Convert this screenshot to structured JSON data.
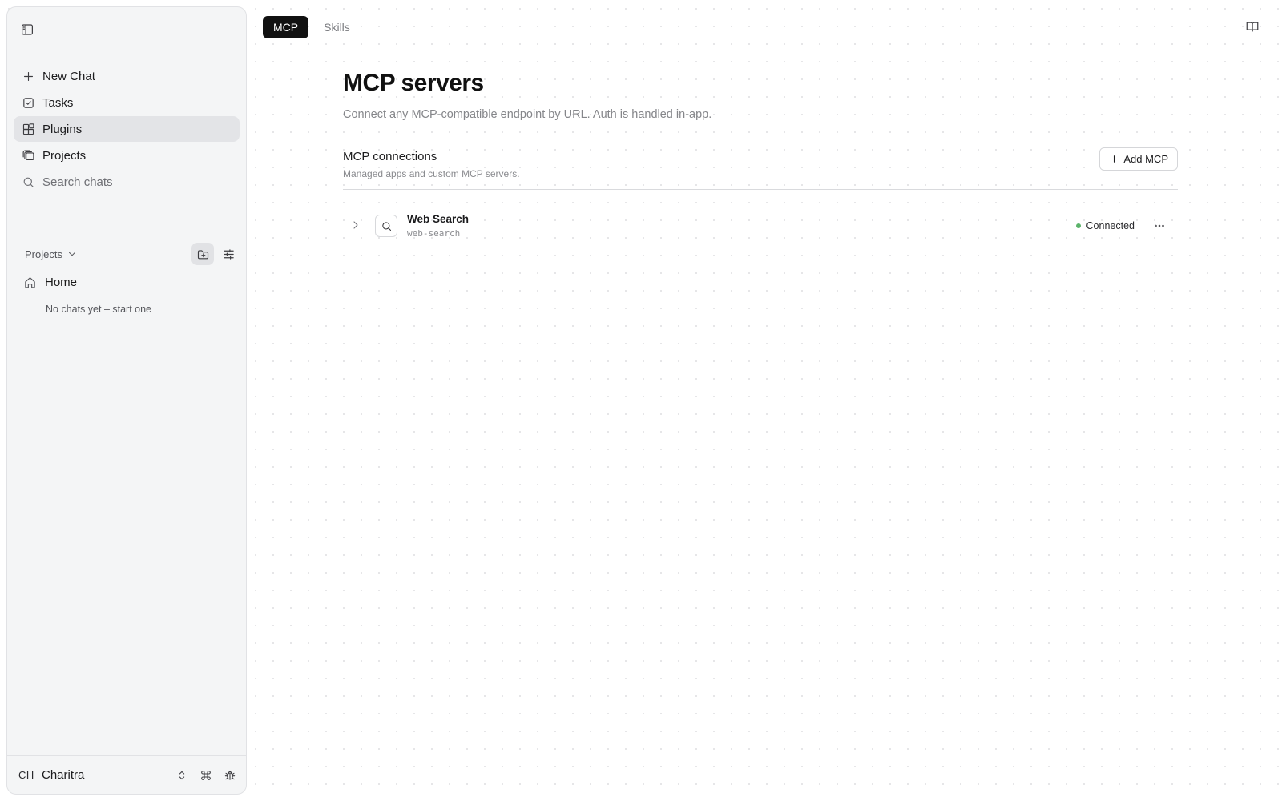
{
  "sidebar": {
    "toggle_icon": "sidebar-panel-icon",
    "nav": [
      {
        "label": "New Chat",
        "icon": "plus-icon"
      },
      {
        "label": "Tasks",
        "icon": "check-square-icon"
      },
      {
        "label": "Plugins",
        "icon": "blocks-icon",
        "active": true
      },
      {
        "label": "Projects",
        "icon": "stack-icon"
      },
      {
        "label": "Search chats",
        "icon": "search-icon"
      }
    ],
    "projects_label": "Projects",
    "home_label": "Home",
    "empty_note": "No chats yet – start one",
    "user": {
      "initials": "CH",
      "name": "Charitra"
    }
  },
  "topbar": {
    "tabs": [
      {
        "label": "MCP",
        "active": true
      },
      {
        "label": "Skills",
        "active": false
      }
    ]
  },
  "main": {
    "title": "MCP servers",
    "subtitle": "Connect any MCP-compatible endpoint by URL. Auth is handled in-app.",
    "section_title": "MCP connections",
    "section_desc": "Managed apps and custom MCP servers.",
    "add_button": "Add MCP",
    "servers": [
      {
        "name": "Web Search",
        "slug": "web-search",
        "status": "Connected",
        "status_color": "#5bb36a"
      }
    ]
  },
  "colors": {
    "accent": "#111111",
    "sidebar_bg": "#f4f5f6",
    "active_nav": "#e3e4e7"
  }
}
